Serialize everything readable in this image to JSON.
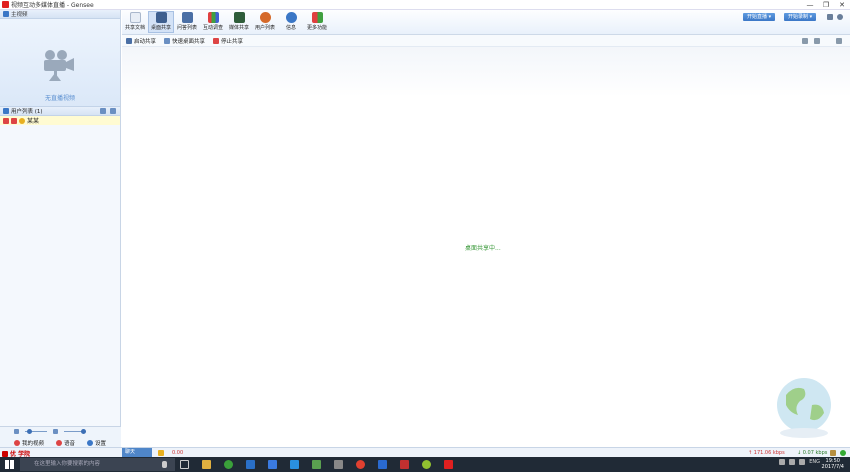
{
  "window": {
    "title": "视频互动多媒体直播 - Gensee",
    "minimize": "—",
    "maximize": "❐",
    "close": "✕"
  },
  "left_panel": {
    "video_header": "主视频",
    "no_video_text": "无直播视频",
    "user_list_header": "用户列表 (1)",
    "users": [
      {
        "name": "某某"
      }
    ],
    "bottom": {
      "my_video": "我的视频",
      "voice": "语音",
      "settings": "设置"
    }
  },
  "toolbar": {
    "items": [
      {
        "label": "共享文档"
      },
      {
        "label": "桌面共享"
      },
      {
        "label": "问答列表"
      },
      {
        "label": "互动调查"
      },
      {
        "label": "媒体共享"
      },
      {
        "label": "用户列表"
      },
      {
        "label": "信息"
      },
      {
        "label": "更多功能"
      }
    ],
    "start_live": "开始直播 ▾",
    "start_record": "开始录制 ▾"
  },
  "subbar": {
    "launch": "启动共享",
    "quick_share": "快速桌面共享",
    "stop": "停止共享"
  },
  "main": {
    "status": "桌面共享中..."
  },
  "statusbar": {
    "brand": "优 学院",
    "chat": "聊天",
    "counter": "0.00",
    "upload": "↑ 171.06 kbps",
    "download": "↓ 0.07 kbps"
  },
  "taskbar": {
    "search_placeholder": "在这里输入你要搜索的内容",
    "lang": "ENG",
    "time": "19:50",
    "date": "2017/7/4"
  },
  "colors": {
    "accent": "#3b77c6",
    "status_green": "#3b9a3b",
    "brand_red": "#cc0000"
  }
}
